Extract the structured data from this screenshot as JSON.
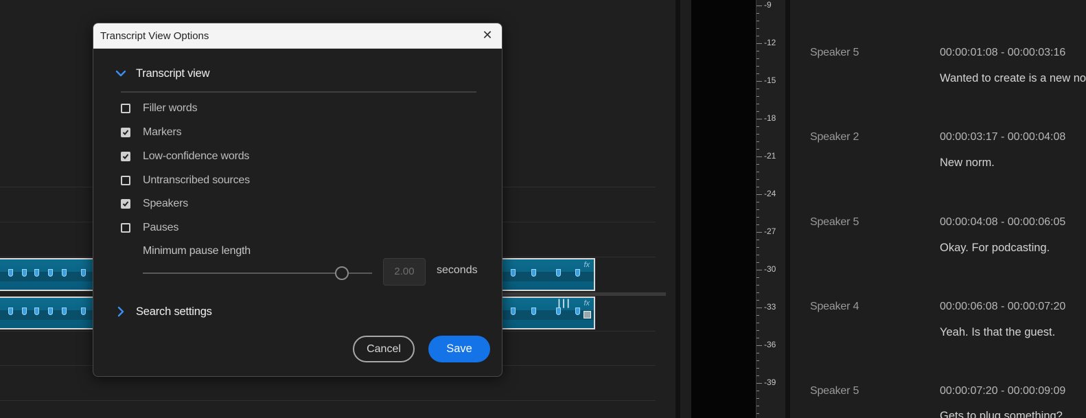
{
  "dialog": {
    "title": "Transcript View Options",
    "close_icon": "close-icon",
    "transcript_view": {
      "title": "Transcript view",
      "expanded": true,
      "options": [
        {
          "label": "Filler words",
          "checked": false
        },
        {
          "label": "Markers",
          "checked": true
        },
        {
          "label": "Low-confidence words",
          "checked": true
        },
        {
          "label": "Untranscribed sources",
          "checked": false
        },
        {
          "label": "Speakers",
          "checked": true
        },
        {
          "label": "Pauses",
          "checked": false
        }
      ],
      "min_pause": {
        "label": "Minimum pause length",
        "value": "2.00",
        "unit": "seconds"
      }
    },
    "search_settings": {
      "title": "Search settings",
      "expanded": false
    },
    "cancel_label": "Cancel",
    "save_label": "Save",
    "accent": "#1473e6"
  },
  "meter": {
    "ticks": [
      "-9",
      "-12",
      "-15",
      "-18",
      "-21",
      "-24",
      "-27",
      "-30",
      "-33",
      "-36",
      "-39"
    ]
  },
  "transcript": {
    "entries": [
      {
        "speaker": "Speaker 5",
        "time": "00:00:01:08 - 00:00:03:16",
        "text": "Wanted to create is a new norm."
      },
      {
        "speaker": "Speaker 2",
        "time": "00:00:03:17 - 00:00:04:08",
        "text": "New norm."
      },
      {
        "speaker": "Speaker 5",
        "time": "00:00:04:08 - 00:00:06:05",
        "text": "Okay. For podcasting."
      },
      {
        "speaker": "Speaker 4",
        "time": "00:00:06:08 - 00:00:07:20",
        "text": "Yeah. Is that the guest."
      },
      {
        "speaker": "Speaker 5",
        "time": "00:00:07:20 - 00:00:09:09",
        "text": "Gets to plug something?"
      }
    ]
  },
  "timeline": {
    "clip_fx_label": "fx"
  }
}
